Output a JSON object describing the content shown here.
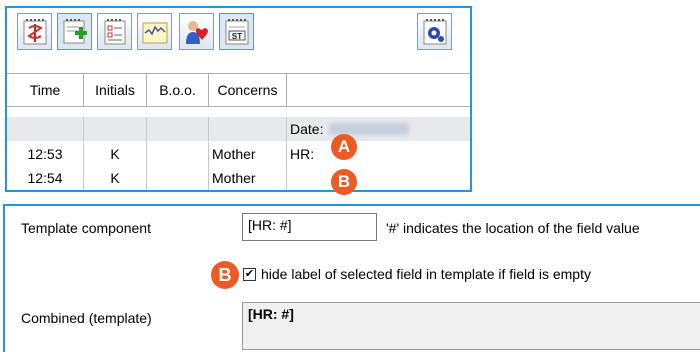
{
  "toolbar": {
    "buttons": [
      {
        "icon": "caduceus-notes-icon"
      },
      {
        "icon": "add-entry-icon"
      },
      {
        "icon": "checklist-icon"
      },
      {
        "icon": "chart-graph-icon"
      },
      {
        "icon": "patient-heart-icon"
      },
      {
        "icon": "st-label-icon",
        "label": "ST"
      },
      {
        "icon": "settings-notes-icon"
      }
    ]
  },
  "grid": {
    "columns": [
      "Time",
      "Initials",
      "B.o.o.",
      "Concerns"
    ],
    "date_row": {
      "label": "Date:",
      "value": "04-12-2021"
    },
    "rows": [
      {
        "time": "12:53",
        "initials": "K",
        "boo": "",
        "concerns": "Mother",
        "extra": "HR:",
        "badge": "A"
      },
      {
        "time": "12:54",
        "initials": "K",
        "boo": "",
        "concerns": "Mother",
        "extra": "",
        "badge": "B"
      }
    ]
  },
  "template": {
    "component_label": "Template  component",
    "component_value": "[HR: #]",
    "hint": "'#' indicates the location of the field value",
    "hide_label_text": "hide label of selected field in template if field is empty",
    "hide_label_checked": true,
    "hide_label_badge": "B",
    "combined_label": "Combined (template)",
    "combined_value": "[HR: #]"
  },
  "colors": {
    "accent_border": "#1e9ad8",
    "badge": "#ee5a24",
    "date_row": "#e7e9ed"
  }
}
